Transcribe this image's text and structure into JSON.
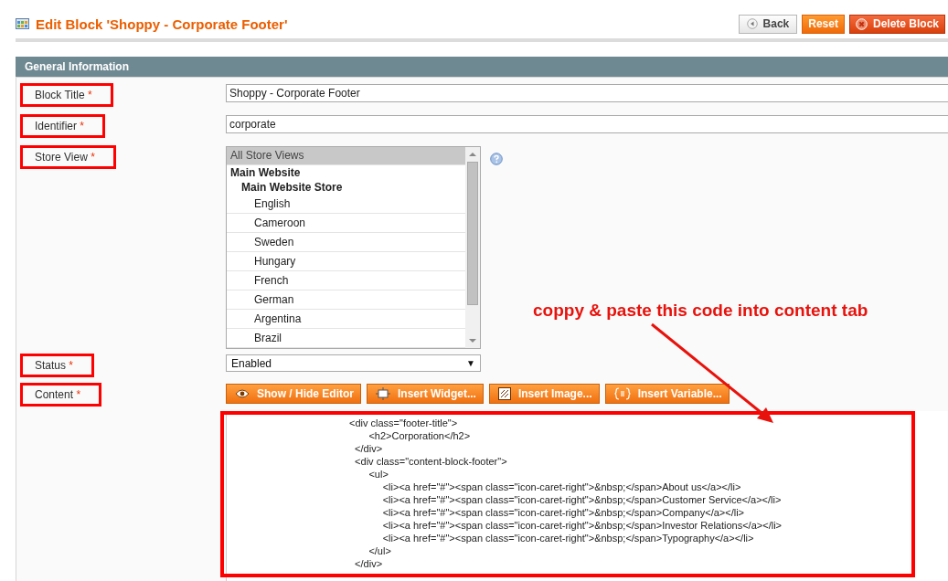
{
  "header": {
    "title": "Edit Block 'Shoppy - Corporate Footer'",
    "buttons": [
      {
        "kind": "back",
        "label": "Back"
      },
      {
        "kind": "reset",
        "label": "Reset"
      },
      {
        "kind": "delete",
        "label": "Delete Block"
      }
    ]
  },
  "section": {
    "title": "General Information"
  },
  "fields": [
    {
      "kind": "text",
      "label": "Block Title",
      "required": "*",
      "highlighted": true,
      "value": "Shoppy - Corporate Footer"
    },
    {
      "kind": "text",
      "label": "Identifier",
      "required": "*",
      "highlighted": true,
      "value": "corporate"
    },
    {
      "kind": "multiselect",
      "label": "Store View",
      "required": "*",
      "highlighted": true,
      "options": [
        {
          "label": "All Store Views",
          "selected": true
        },
        {
          "label": "Main Website",
          "children": [
            {
              "label": "Main Website Store",
              "children": [
                {
                  "label": "English",
                  "selected": false
                },
                {
                  "label": "Cameroon",
                  "selected": false
                },
                {
                  "label": "Sweden",
                  "selected": false
                },
                {
                  "label": "Hungary",
                  "selected": false
                },
                {
                  "label": "French",
                  "selected": false
                },
                {
                  "label": "German",
                  "selected": false
                },
                {
                  "label": "Argentina",
                  "selected": false
                },
                {
                  "label": "Brazil",
                  "selected": false
                }
              ]
            }
          ]
        }
      ]
    },
    {
      "kind": "select",
      "label": "Status",
      "required": "*",
      "highlighted": true,
      "value": "Enabled",
      "caret": "▼"
    },
    {
      "kind": "editor",
      "label": "Content",
      "required": "*",
      "highlighted": true,
      "buttons": [
        {
          "kind": "eye",
          "label": "Show / Hide Editor"
        },
        {
          "kind": "widget",
          "label": "Insert Widget..."
        },
        {
          "kind": "image",
          "label": "Insert Image..."
        },
        {
          "kind": "variable",
          "label": "Insert Variable..."
        }
      ],
      "code_highlighted": true,
      "code": [
        "<div class=\"footer-title\">",
        "       <h2>Corporation</h2>",
        "  </div>",
        "  <div class=\"content-block-footer\">",
        "       <ul>",
        "            <li><a href=\"#\"><span class=\"icon-caret-right\">&nbsp;</span>About us</a></li>",
        "            <li><a href=\"#\"><span class=\"icon-caret-right\">&nbsp;</span>Customer Service</a></li>",
        "            <li><a href=\"#\"><span class=\"icon-caret-right\">&nbsp;</span>Company</a></li>",
        "            <li><a href=\"#\"><span class=\"icon-caret-right\">&nbsp;</span>Investor Relations</a></li>",
        "            <li><a href=\"#\"><span class=\"icon-caret-right\">&nbsp;</span>Typography</a></li>",
        "       </ul>",
        "  </div>"
      ]
    }
  ],
  "annotation": {
    "text": "coppy & paste this code into content tab"
  }
}
